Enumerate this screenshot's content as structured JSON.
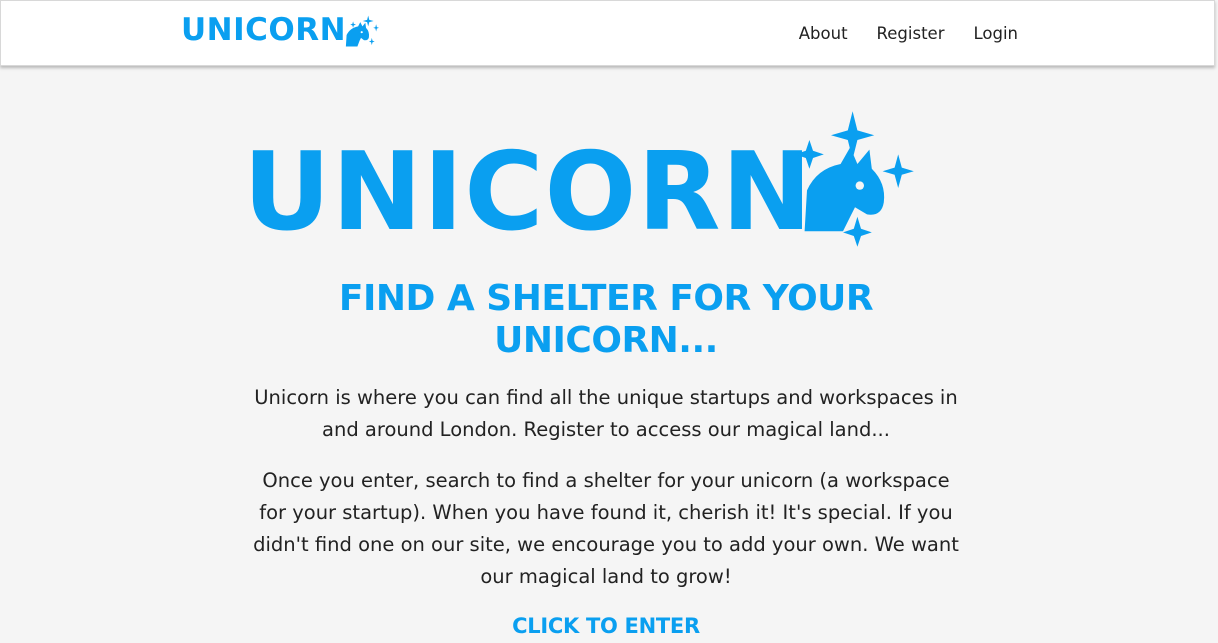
{
  "brand": {
    "name": "UNICORN",
    "logo_icon": "unicorn-head-sparkles-icon",
    "color": "#0a9ff0"
  },
  "nav": {
    "items": [
      {
        "label": "About"
      },
      {
        "label": "Register"
      },
      {
        "label": "Login"
      }
    ]
  },
  "hero": {
    "title": "UNICORN",
    "headline": "FIND A SHELTER FOR YOUR UNICORN...",
    "paragraphs": [
      "Unicorn is where you can find all the unique startups and workspaces in and around London. Register to access our magical land...",
      "Once you enter, search to find a shelter for your unicorn (a workspace for your startup). When you have found it, cherish it! It's special. If you didn't find one on our site, we encourage you to add your own. We want our magical land to grow!"
    ],
    "cta_label": "CLICK TO ENTER"
  }
}
